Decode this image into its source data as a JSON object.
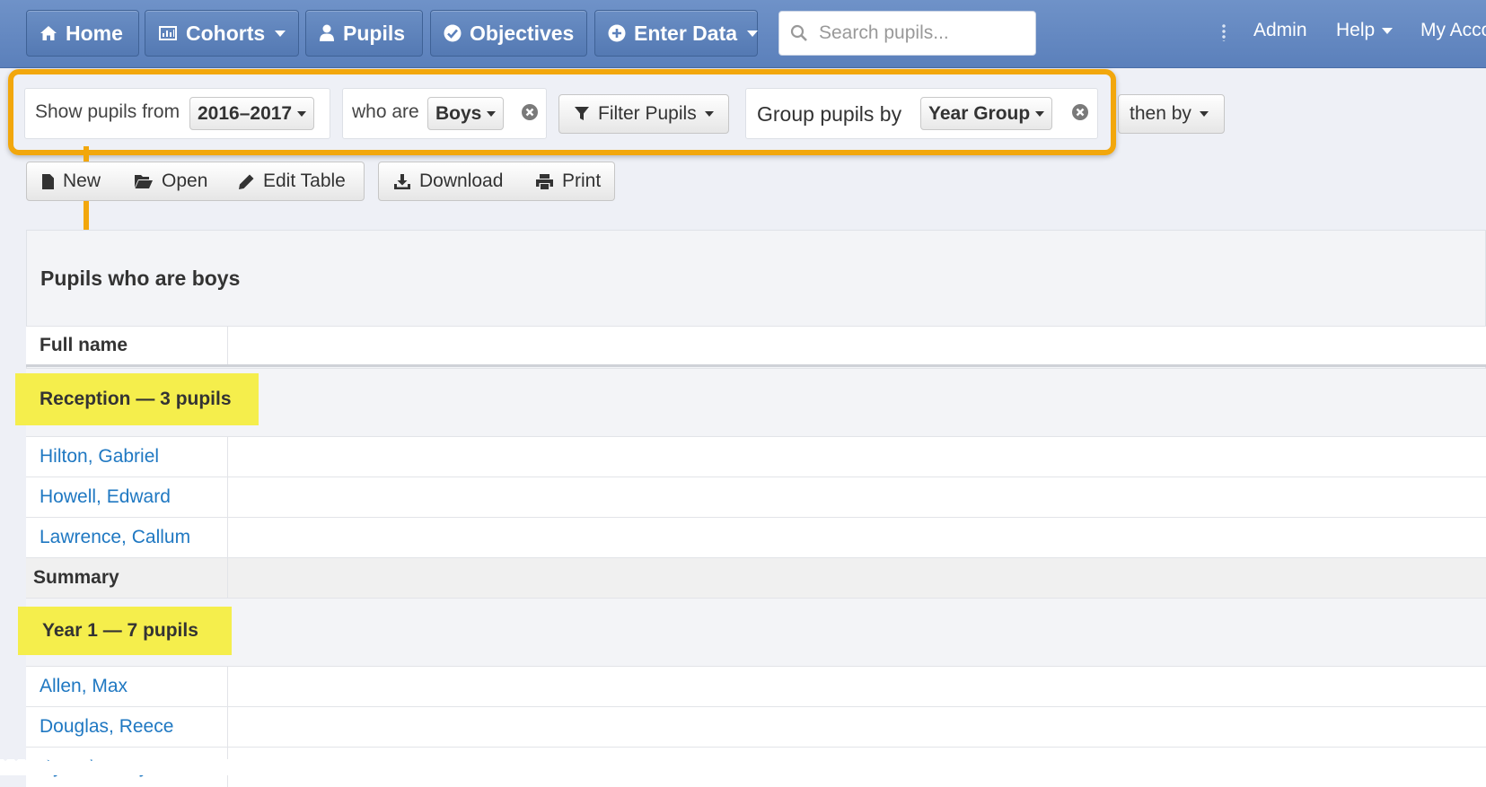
{
  "nav": {
    "home": "Home",
    "cohorts": "Cohorts",
    "pupils": "Pupils",
    "objectives": "Objectives",
    "enter_data": "Enter Data",
    "search_placeholder": "Search pupils...",
    "admin": "Admin",
    "help": "Help",
    "my_account": "My Acco"
  },
  "filters": {
    "show_from_label": "Show pupils from",
    "year_value": "2016–2017",
    "who_are_label": "who are",
    "who_are_value": "Boys",
    "filter_button": "Filter Pupils",
    "group_by_label": "Group pupils by",
    "group_by_value": "Year Group",
    "then_by_label": "then by"
  },
  "toolbar": {
    "new": "New",
    "open": "Open",
    "edit_table": "Edit Table",
    "download": "Download",
    "print": "Print"
  },
  "table": {
    "title": "Pupils who are boys",
    "header_full_name": "Full name",
    "groups": [
      {
        "label": "Reception — 3 pupils",
        "pupils": [
          "Hilton, Gabriel",
          "Howell, Edward",
          "Lawrence, Callum"
        ],
        "summary": "Summary"
      },
      {
        "label": "Year 1 — 7 pupils",
        "pupils": [
          "Allen, Max",
          "Douglas, Reece",
          "Dyer, Harvey"
        ]
      }
    ]
  },
  "colors": {
    "nav_blue": "#5b80bb",
    "highlight_orange": "#f2a70c",
    "group_yellow": "#f5ee4c",
    "link_blue": "#1f78c2"
  }
}
